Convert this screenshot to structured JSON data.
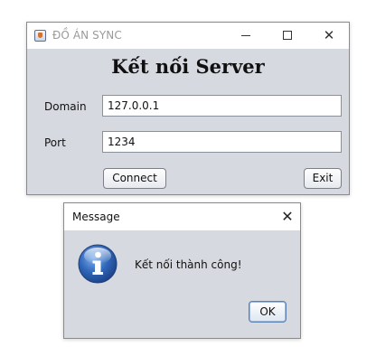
{
  "main_window": {
    "title": "ĐỒ ÁN SYNC",
    "controls": {
      "minimize_icon": "minimize-icon",
      "maximize_icon": "maximize-icon",
      "close_glyph": "✕"
    },
    "heading": "Kết nối Server",
    "domain": {
      "label": "Domain",
      "value": "127.0.0.1"
    },
    "port": {
      "label": "Port",
      "value": "1234"
    },
    "connect_label": "Connect",
    "exit_label": "Exit"
  },
  "message_dialog": {
    "title": "Message",
    "close_glyph": "✕",
    "icon": "info-icon",
    "text": "Kết nối thành công!",
    "ok_label": "OK"
  },
  "colors": {
    "window_body": "#d6d9df",
    "titlebar": "#ffffff",
    "info_icon_blue": "#2f65b8"
  }
}
